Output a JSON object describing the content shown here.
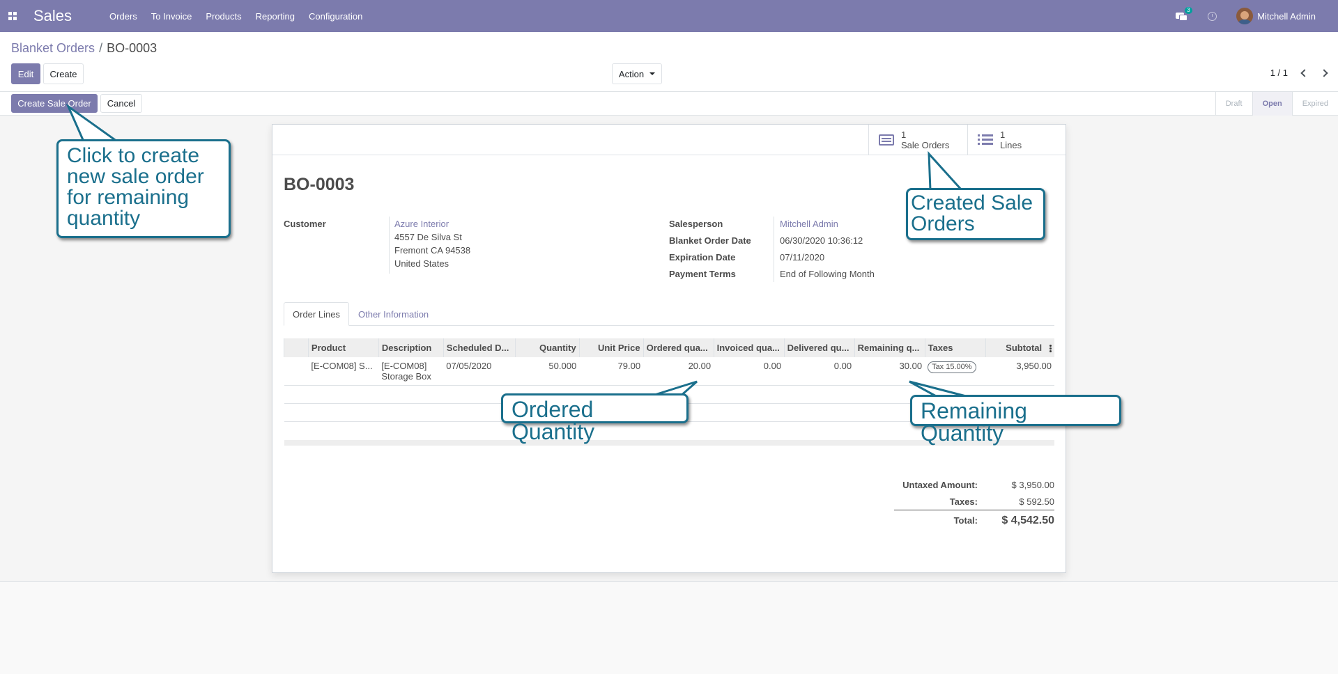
{
  "navbar": {
    "app_name": "Sales",
    "menu": [
      "Orders",
      "To Invoice",
      "Products",
      "Reporting",
      "Configuration"
    ],
    "chat_count": "3",
    "user_name": "Mitchell Admin",
    "icons": [
      "apps-icon",
      "chat-icon",
      "clock-icon",
      "avatar"
    ]
  },
  "breadcrumb": {
    "parent": "Blanket Orders",
    "separator": "/",
    "current": "BO-0003"
  },
  "toolbar": {
    "edit_label": "Edit",
    "create_label": "Create",
    "action_label": "Action"
  },
  "pager": {
    "value": "1 / 1"
  },
  "statusbar": {
    "create_sale_order_label": "Create Sale Order",
    "cancel_label": "Cancel",
    "stages": [
      "Draft",
      "Open",
      "Expired"
    ],
    "active_stage": "Open"
  },
  "smart_buttons": {
    "sale_orders": {
      "count": "1",
      "label": "Sale Orders"
    },
    "lines": {
      "count": "1",
      "label": "Lines"
    }
  },
  "record": {
    "name": "BO-0003",
    "customer_label": "Customer",
    "customer_name": "Azure Interior",
    "address_line1": "4557 De Silva St",
    "address_line2": "Fremont CA 94538",
    "address_line3": "United States",
    "salesperson_label": "Salesperson",
    "salesperson": "Mitchell Admin",
    "order_date_label": "Blanket Order Date",
    "order_date": "06/30/2020 10:36:12",
    "expiration_label": "Expiration Date",
    "expiration_date": "07/11/2020",
    "payment_terms_label": "Payment Terms",
    "payment_terms": "End of Following Month"
  },
  "tabs": {
    "order_lines": "Order Lines",
    "other_info": "Other Information"
  },
  "table": {
    "headers": [
      "Product",
      "Description",
      "Scheduled D...",
      "Quantity",
      "Unit Price",
      "Ordered qua...",
      "Invoiced qua...",
      "Delivered qu...",
      "Remaining q...",
      "Taxes",
      "Subtotal"
    ],
    "rows": [
      {
        "product": "[E-COM08] S...",
        "description_line1": "[E-COM08]",
        "description_line2": "Storage Box",
        "scheduled": "07/05/2020",
        "quantity": "50.000",
        "unit_price": "79.00",
        "ordered": "20.00",
        "invoiced": "0.00",
        "delivered": "0.00",
        "remaining": "30.00",
        "tax": "Tax 15.00%",
        "subtotal": "3,950.00"
      }
    ]
  },
  "totals": {
    "untaxed_label": "Untaxed Amount:",
    "untaxed_value": "$ 3,950.00",
    "taxes_label": "Taxes:",
    "taxes_value": "$ 592.50",
    "total_label": "Total:",
    "total_value": "$ 4,542.50"
  },
  "callouts": {
    "create_order_line1": "Click to create",
    "create_order_line2": "new sale order",
    "create_order_line3": "for remaining",
    "create_order_line4": "quantity",
    "created_line1": "Created Sale",
    "created_line2": "Orders",
    "ordered_qty": "Ordered Quantity",
    "remaining_qty": "Remaining Quantity"
  },
  "colors": {
    "brand": "#7c7bad",
    "callout": "#1a6f8c"
  }
}
